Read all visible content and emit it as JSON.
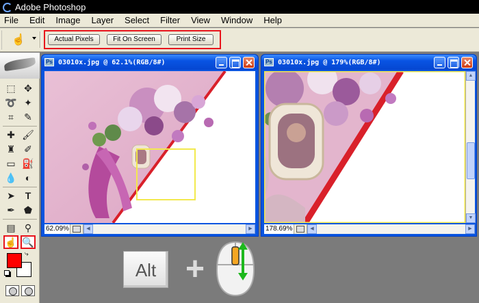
{
  "app": {
    "title": "Adobe Photoshop"
  },
  "menu": [
    "File",
    "Edit",
    "Image",
    "Layer",
    "Select",
    "Filter",
    "View",
    "Window",
    "Help"
  ],
  "options_bar": {
    "buttons": [
      "Actual Pixels",
      "Fit On Screen",
      "Print Size"
    ]
  },
  "colors": {
    "foreground": "#ff0000",
    "background": "#ffffff",
    "highlight": "#e8141c",
    "overview_rect": "#f2e94e"
  },
  "doc_left": {
    "title": "03010x.jpg @ 62.1%(RGB/8#)",
    "zoom": "62.09%"
  },
  "doc_right": {
    "title": "03010x.jpg @ 179%(RGB/8#)",
    "zoom": "178.69%"
  },
  "hint": {
    "key": "Alt",
    "plus": "+"
  }
}
